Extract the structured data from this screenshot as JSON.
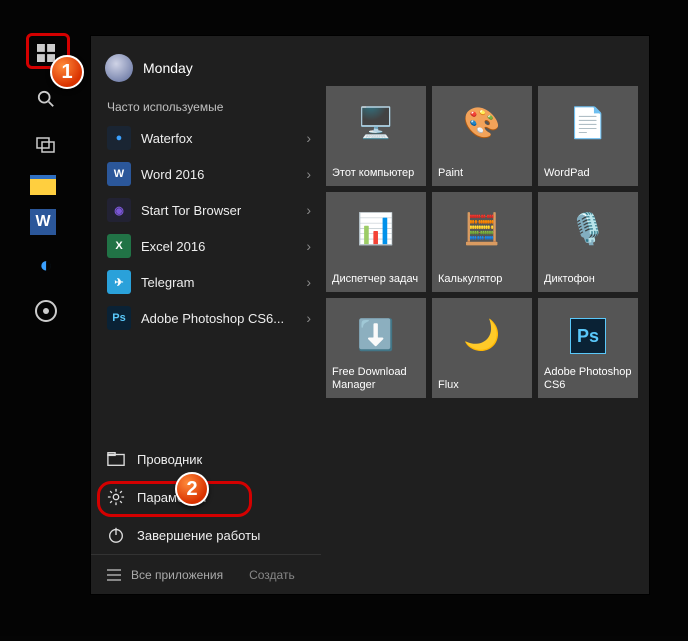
{
  "badges": {
    "one": "1",
    "two": "2"
  },
  "user": {
    "name": "Monday"
  },
  "sections": {
    "most_used": "Часто используемые"
  },
  "apps": [
    {
      "label": "Waterfox",
      "bg": "#1a2533",
      "glyph": "●",
      "glyphColor": "#3aa0ff"
    },
    {
      "label": "Word 2016",
      "bg": "#2b579a",
      "glyph": "W",
      "glyphColor": "#fff"
    },
    {
      "label": "Start Tor Browser",
      "bg": "#222233",
      "glyph": "◉",
      "glyphColor": "#7a56d6"
    },
    {
      "label": "Excel 2016",
      "bg": "#217346",
      "glyph": "X",
      "glyphColor": "#fff"
    },
    {
      "label": "Telegram",
      "bg": "#2aa1da",
      "glyph": "✈",
      "glyphColor": "#fff"
    },
    {
      "label": "Adobe Photoshop CS6...",
      "bg": "#0a2235",
      "glyph": "Ps",
      "glyphColor": "#5ac8fa"
    }
  ],
  "system": {
    "explorer": "Проводник",
    "settings": "Параметры",
    "power": "Завершение работы"
  },
  "bottom": {
    "all_apps": "Все приложения",
    "create": "Создать"
  },
  "tiles": [
    {
      "label": "Этот компьютер",
      "glyph": "🖥️"
    },
    {
      "label": "Paint",
      "glyph": "🎨"
    },
    {
      "label": "WordPad",
      "glyph": "📄"
    },
    {
      "label": "Диспетчер задач",
      "glyph": "📊"
    },
    {
      "label": "Калькулятор",
      "glyph": "🧮"
    },
    {
      "label": "Диктофон",
      "glyph": "🎙️"
    },
    {
      "label": "Free Download Manager",
      "glyph": "⬇️"
    },
    {
      "label": "Flux",
      "glyph": "🌙"
    },
    {
      "label": "Adobe Photoshop CS6",
      "glyph": "Ps"
    }
  ]
}
